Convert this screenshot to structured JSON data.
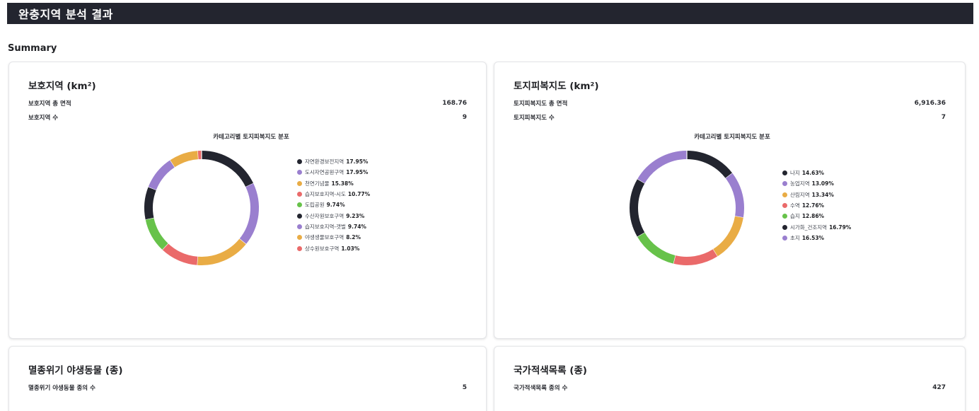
{
  "header": {
    "title": "완충지역 분석 결과"
  },
  "summary_label": "Summary",
  "cards": {
    "protected": {
      "title": "보호지역 (km²)",
      "rows": [
        {
          "label": "보호지역 총 면적",
          "value": "168.76"
        },
        {
          "label": "보호지역 수",
          "value": "9"
        }
      ],
      "chart_title": "카테고리별 토지피복지도 분포"
    },
    "landcover": {
      "title": "토지피복지도 (km²)",
      "rows": [
        {
          "label": "토지피복지도 총 면적",
          "value": "6,916.36"
        },
        {
          "label": "토지피복지도 수",
          "value": "7"
        }
      ],
      "chart_title": "카테고리별 토지피복지도 분포"
    },
    "endangered": {
      "title": "멸종위기 야생동물 (종)",
      "rows": [
        {
          "label": "멸종위기 야생동물 종의 수",
          "value": "5"
        }
      ]
    },
    "redlist": {
      "title": "국가적색목록 (종)",
      "rows": [
        {
          "label": "국가적색목록 종의 수",
          "value": "427"
        }
      ]
    }
  },
  "colors": {
    "dark": "#23252f",
    "purple": "#9a7fcf",
    "orange": "#e9ac45",
    "red": "#ea6a6a",
    "green": "#67c24a"
  },
  "chart_data": [
    {
      "type": "pie",
      "title": "카테고리별 토지피복지도 분포",
      "slices": [
        {
          "label": "자연환경보전지역",
          "value": 17.95,
          "pct_text": "17.95%",
          "color": "#23252f"
        },
        {
          "label": "도시자연공원구역",
          "value": 17.95,
          "pct_text": "17.95%",
          "color": "#9a7fcf"
        },
        {
          "label": "천연기념물",
          "value": 15.38,
          "pct_text": "15.38%",
          "color": "#e9ac45"
        },
        {
          "label": "습지보호지역-시도",
          "value": 10.77,
          "pct_text": "10.77%",
          "color": "#ea6a6a"
        },
        {
          "label": "도립공원",
          "value": 9.74,
          "pct_text": "9.74%",
          "color": "#67c24a"
        },
        {
          "label": "수산자원보호구역",
          "value": 9.23,
          "pct_text": "9.23%",
          "color": "#23252f"
        },
        {
          "label": "습지보호지역-갯벌",
          "value": 9.74,
          "pct_text": "9.74%",
          "color": "#9a7fcf"
        },
        {
          "label": "야생생물보호구역",
          "value": 8.2,
          "pct_text": "8.2%",
          "color": "#e9ac45"
        },
        {
          "label": "상수원보호구역",
          "value": 1.03,
          "pct_text": "1.03%",
          "color": "#ea6a6a"
        }
      ],
      "legend_position": "right"
    },
    {
      "type": "pie",
      "title": "카테고리별 토지피복지도 분포",
      "slices": [
        {
          "label": "나지",
          "value": 14.63,
          "pct_text": "14.63%",
          "color": "#23252f"
        },
        {
          "label": "농업지역",
          "value": 13.09,
          "pct_text": "13.09%",
          "color": "#9a7fcf"
        },
        {
          "label": "산림지역",
          "value": 13.34,
          "pct_text": "13.34%",
          "color": "#e9ac45"
        },
        {
          "label": "수역",
          "value": 12.76,
          "pct_text": "12.76%",
          "color": "#ea6a6a"
        },
        {
          "label": "습지",
          "value": 12.86,
          "pct_text": "12.86%",
          "color": "#67c24a"
        },
        {
          "label": "시가화_건조지역",
          "value": 16.79,
          "pct_text": "16.79%",
          "color": "#23252f"
        },
        {
          "label": "초지",
          "value": 16.53,
          "pct_text": "16.53%",
          "color": "#9a7fcf"
        }
      ],
      "legend_position": "right"
    }
  ]
}
